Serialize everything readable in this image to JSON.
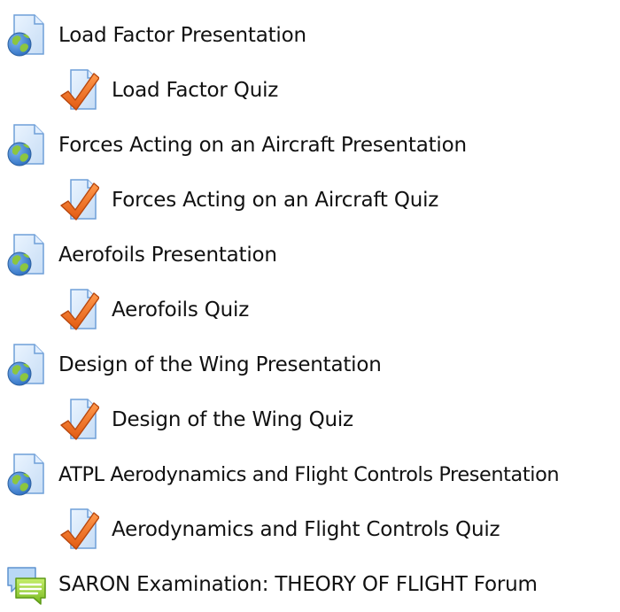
{
  "items": [
    {
      "label": "Load Factor Presentation",
      "icon": "globe-page-icon",
      "type": "presentation"
    },
    {
      "label": "Load Factor Quiz",
      "icon": "quiz-checkmark-icon",
      "type": "quiz"
    },
    {
      "label": "Forces Acting on an Aircraft Presentation",
      "icon": "globe-page-icon",
      "type": "presentation"
    },
    {
      "label": "Forces Acting on an Aircraft Quiz",
      "icon": "quiz-checkmark-icon",
      "type": "quiz"
    },
    {
      "label": "Aerofoils Presentation",
      "icon": "globe-page-icon",
      "type": "presentation"
    },
    {
      "label": "Aerofoils Quiz",
      "icon": "quiz-checkmark-icon",
      "type": "quiz"
    },
    {
      "label": "Design of the Wing Presentation",
      "icon": "globe-page-icon",
      "type": "presentation"
    },
    {
      "label": "Design of the Wing Quiz",
      "icon": "quiz-checkmark-icon",
      "type": "quiz"
    },
    {
      "label": "ATPL Aerodynamics and Flight Controls Presentation",
      "icon": "globe-page-icon",
      "type": "presentation"
    },
    {
      "label": "Aerodynamics and Flight Controls Quiz",
      "icon": "quiz-checkmark-icon",
      "type": "quiz"
    },
    {
      "label": "SARON Examination: THEORY OF FLIGHT Forum",
      "icon": "forum-speech-bubbles-icon",
      "type": "forum"
    }
  ],
  "colors": {
    "page_fill": "#cfe3f7",
    "page_outline": "#6f9fd8",
    "globe_ocean": "#3b7fd0",
    "globe_land": "#8cc63f",
    "check_fill": "#f26f21",
    "check_outline": "#b8470d",
    "forum_back": "#a9cdf2",
    "forum_front": "#9bd33b"
  }
}
